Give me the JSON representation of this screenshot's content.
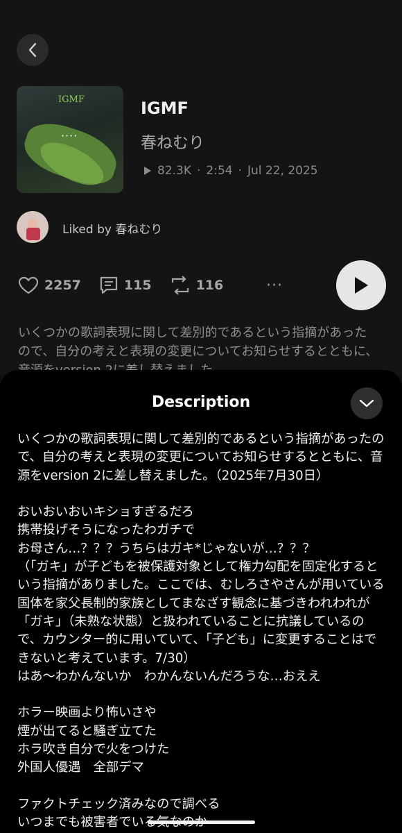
{
  "track": {
    "title": "IGMF",
    "artist": "春ねむり",
    "plays": "82.3K",
    "duration": "2:54",
    "date": "Jul 22, 2025",
    "separator": "·"
  },
  "cover": {
    "tag_text": "IGMF",
    "overlay_dots": "····"
  },
  "liked_by": {
    "prefix": "Liked by",
    "name": "春ねむり"
  },
  "actions": {
    "likes": "2257",
    "comments": "115",
    "reposts": "116",
    "more_icon": "more-horizontal-icon"
  },
  "preview_text": "いくつかの歌詞表現に関して差別的であるという指摘があったので、自分の考えと表現の変更についてお知らせするとともに、音源をversion 2に差し替えました",
  "description": {
    "title": "Description",
    "paragraphs": [
      "いくつかの歌詞表現に関して差別的であるという指摘があったので、自分の考えと表現の変更についてお知らせするとともに、音源をversion 2に差し替えました。（2025年7月30日）",
      "",
      "おいおいおいキショすぎるだろ",
      "携帯投げそうになったわガチで",
      "お母さん…？？？うちらはガキ*じゃないが…？？？",
      "（「ガキ」が子どもを被保護対象として権力勾配を固定化するという指摘がありました。ここでは、むしろさやさんが用いている国体を家父長制的家族としてまなざす観念に基づきわれわれが「ガキ」（未熟な状態）と扱われていることに抗議しているので、カウンター的に用いていて、「子ども」に変更することはできないと考えています。7/30）",
      "はあ〜わかんないか　わかんないんだろうな…おええ",
      "",
      "ホラー映画より怖いさや",
      "煙が出てると騒ぎ立てた",
      "ホラ吹き自分で火をつけた",
      "外国人優遇　全部デマ",
      "",
      "ファクトチェック済みなので調べる",
      "いつまでも被害者でいる気なのか"
    ]
  },
  "colors": {
    "background": "#111111",
    "sheet": "#000000",
    "muted": "#8e8e8e",
    "button": "#e6e6e6"
  }
}
